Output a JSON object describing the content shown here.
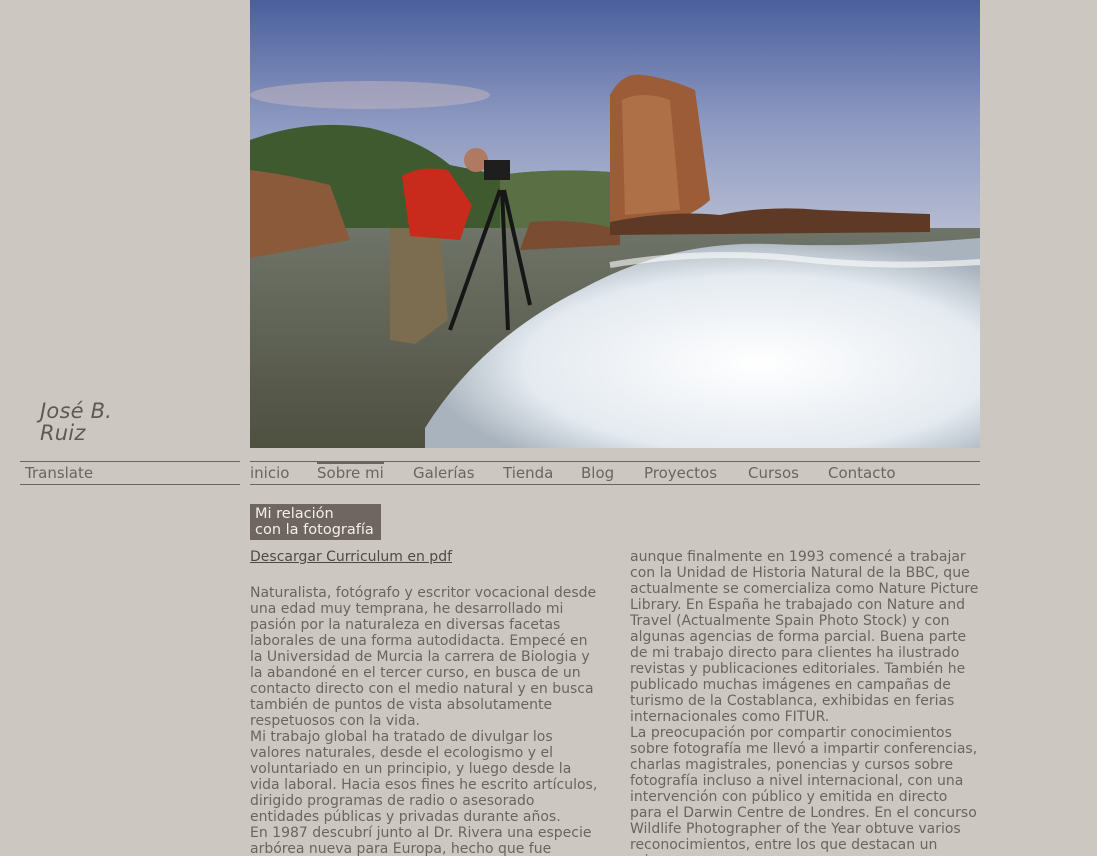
{
  "site": {
    "title_line1": "José B.",
    "title_line2": "Ruiz"
  },
  "translate": {
    "label": "Translate"
  },
  "nav": {
    "items": [
      {
        "label": "inicio"
      },
      {
        "label": "Sobre mi"
      },
      {
        "label": "Galerías"
      },
      {
        "label": "Tienda"
      },
      {
        "label": "Blog"
      },
      {
        "label": "Proyectos"
      },
      {
        "label": "Cursos"
      },
      {
        "label": "Contacto"
      }
    ],
    "active": "Sobre mi"
  },
  "section": {
    "badge_line1": "Mi relación",
    "badge_line2": "con la fotografía",
    "cv_link": "Descargar Curriculum en pdf"
  },
  "content": {
    "left_paragraphs": [
      "Naturalista, fotógrafo y escritor vocacional desde una edad muy temprana, he desarrollado mi pasión por la naturaleza en diversas facetas laborales de una forma autodidacta. Empecé en la Universidad de Murcia la carrera de Biologia y la abandoné en el tercer curso, en busca de un contacto directo con el medio natural y en busca también de puntos de vista absolutamente respetuosos con la vida.",
      "Mi trabajo global ha tratado de divulgar los valores naturales, desde el ecologismo y el voluntariado en un principio, y luego desde la vida laboral. Hacia esos fines he escrito artículos, dirigido programas de radio o asesorado entidades públicas y privadas durante años.",
      "En 1987 descubrí junto al Dr. Rivera una especie arbórea nueva para Europa, hecho que fue publicado en diversos medios especializados"
    ],
    "right_paragraphs": [
      "aunque finalmente en 1993 comencé a trabajar con la Unidad de Historia Natural de la BBC, que actualmente se comercializa como Nature Picture Library. En España he trabajado con Nature and Travel (Actualmente Spain Photo Stock) y con algunas agencias de forma parcial. Buena parte de mi trabajo directo para clientes ha ilustrado revistas y publicaciones editoriales. También he publicado muchas imágenes en campañas de turismo de la Costablanca, exhibidas en ferias internacionales como FITUR.",
      "La preocupación por compartir conocimientos sobre fotografía me llevó a impartir conferencias, charlas magistrales, ponencias y cursos sobre fotografía incluso a nivel internacional, con una intervención con público y emitida en directo para el Darwin Centre de Londres. En el concurso Wildlife Photographer of the Year obtuve varios reconocimientos, entre los que destacan un primer"
    ]
  },
  "colors": {
    "background": "#ccc8c1",
    "text": "#6b6460",
    "badge_bg": "#6f6561",
    "badge_text": "#f3efea"
  }
}
